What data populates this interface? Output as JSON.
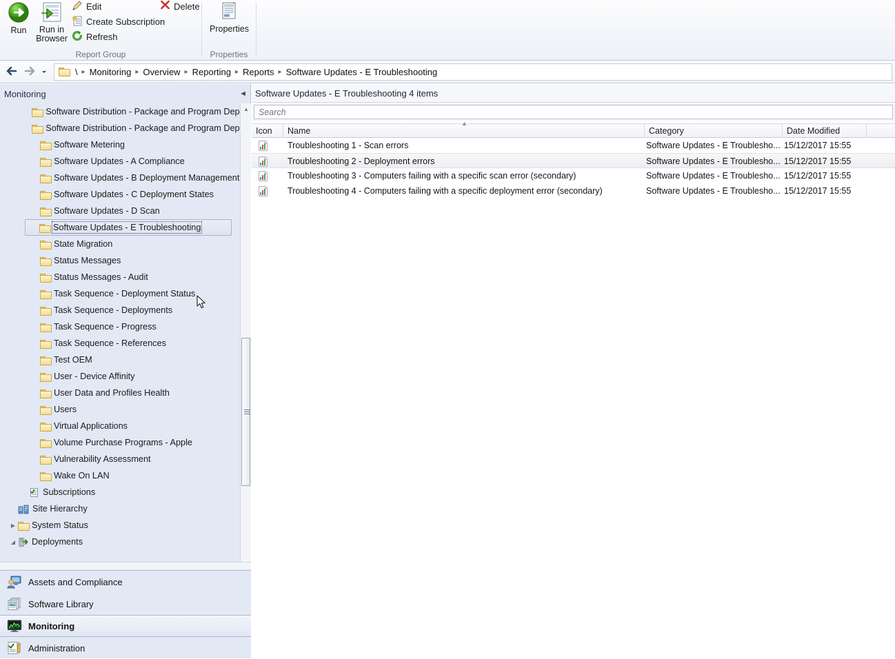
{
  "ribbon": {
    "groups": [
      {
        "label": "Report Group"
      },
      {
        "label": "Properties"
      }
    ],
    "run_label": "Run",
    "run_icon": "run-circle-arrow-icon",
    "run_in_browser_label": "Run in\nBrowser",
    "run_in_browser_line1": "Run in",
    "run_in_browser_line2": "Browser",
    "run_in_browser_icon": "document-arrow-icon",
    "edit_label": "Edit",
    "edit_icon": "pencil-icon",
    "create_subscription_label": "Create Subscription",
    "create_subscription_icon": "clipboard-star-icon",
    "refresh_label": "Refresh",
    "refresh_icon": "refresh-circle-icon",
    "delete_label": "Delete",
    "delete_icon": "red-x-icon",
    "properties_label": "Properties",
    "properties_icon": "properties-document-icon"
  },
  "breadcrumb": {
    "back_icon": "back-arrow-icon",
    "forward_icon": "forward-arrow-icon",
    "history_icon": "chevron-down-icon",
    "root_icon": "folder-icon",
    "root": "\\",
    "items": [
      "Monitoring",
      "Overview",
      "Reporting",
      "Reports",
      "Software Updates - E Troubleshooting"
    ],
    "separator": "▸"
  },
  "sidebar": {
    "title": "Monitoring",
    "collapse_icon": "collapse-left-icon",
    "scroll_up_icon": "scroll-up-arrow-icon",
    "scroll_down_icon": "scroll-down-arrow-icon",
    "tree": [
      {
        "label": "Software Distribution - Package and Program Deplo",
        "icon": "folder-icon",
        "indent": 2,
        "selected": false,
        "expander": ""
      },
      {
        "label": "Software Distribution - Package and Program Deplo",
        "icon": "folder-icon",
        "indent": 2,
        "selected": false,
        "expander": ""
      },
      {
        "label": "Software Metering",
        "icon": "folder-icon",
        "indent": 2,
        "selected": false,
        "expander": ""
      },
      {
        "label": "Software Updates - A Compliance",
        "icon": "folder-icon",
        "indent": 2,
        "selected": false,
        "expander": ""
      },
      {
        "label": "Software Updates - B Deployment Management",
        "icon": "folder-icon",
        "indent": 2,
        "selected": false,
        "expander": ""
      },
      {
        "label": "Software Updates - C Deployment States",
        "icon": "folder-icon",
        "indent": 2,
        "selected": false,
        "expander": ""
      },
      {
        "label": "Software Updates - D Scan",
        "icon": "folder-icon",
        "indent": 2,
        "selected": false,
        "expander": ""
      },
      {
        "label": "Software Updates - E Troubleshooting",
        "icon": "folder-icon",
        "indent": 2,
        "selected": true,
        "expander": ""
      },
      {
        "label": "State Migration",
        "icon": "folder-icon",
        "indent": 2,
        "selected": false,
        "expander": ""
      },
      {
        "label": "Status Messages",
        "icon": "folder-icon",
        "indent": 2,
        "selected": false,
        "expander": ""
      },
      {
        "label": "Status Messages - Audit",
        "icon": "folder-icon",
        "indent": 2,
        "selected": false,
        "expander": ""
      },
      {
        "label": "Task Sequence - Deployment Status",
        "icon": "folder-icon",
        "indent": 2,
        "selected": false,
        "expander": ""
      },
      {
        "label": "Task Sequence - Deployments",
        "icon": "folder-icon",
        "indent": 2,
        "selected": false,
        "expander": ""
      },
      {
        "label": "Task Sequence - Progress",
        "icon": "folder-icon",
        "indent": 2,
        "selected": false,
        "expander": ""
      },
      {
        "label": "Task Sequence - References",
        "icon": "folder-icon",
        "indent": 2,
        "selected": false,
        "expander": ""
      },
      {
        "label": "Test OEM",
        "icon": "folder-icon",
        "indent": 2,
        "selected": false,
        "expander": ""
      },
      {
        "label": "User - Device Affinity",
        "icon": "folder-icon",
        "indent": 2,
        "selected": false,
        "expander": ""
      },
      {
        "label": "User Data and Profiles Health",
        "icon": "folder-icon",
        "indent": 2,
        "selected": false,
        "expander": ""
      },
      {
        "label": "Users",
        "icon": "folder-icon",
        "indent": 2,
        "selected": false,
        "expander": ""
      },
      {
        "label": "Virtual Applications",
        "icon": "folder-icon",
        "indent": 2,
        "selected": false,
        "expander": ""
      },
      {
        "label": "Volume Purchase Programs - Apple",
        "icon": "folder-icon",
        "indent": 2,
        "selected": false,
        "expander": ""
      },
      {
        "label": "Vulnerability Assessment",
        "icon": "folder-icon",
        "indent": 2,
        "selected": false,
        "expander": ""
      },
      {
        "label": "Wake On LAN",
        "icon": "folder-icon",
        "indent": 2,
        "selected": false,
        "expander": ""
      },
      {
        "label": "Subscriptions",
        "icon": "subscriptions-icon",
        "indent": 1,
        "selected": false,
        "expander": ""
      },
      {
        "label": "Site Hierarchy",
        "icon": "site-hierarchy-icon",
        "indent": 0,
        "selected": false,
        "expander": ""
      },
      {
        "label": "System Status",
        "icon": "folder-icon",
        "indent": 0,
        "selected": false,
        "expander": "collapsed"
      },
      {
        "label": "Deployments",
        "icon": "deployments-icon",
        "indent": 0,
        "selected": false,
        "expander": "expanded"
      }
    ],
    "workspaces": [
      {
        "label": "Assets and Compliance",
        "icon": "assets-compliance-icon",
        "active": false
      },
      {
        "label": "Software Library",
        "icon": "software-library-icon",
        "active": false
      },
      {
        "label": "Monitoring",
        "icon": "monitoring-icon",
        "active": true
      },
      {
        "label": "Administration",
        "icon": "administration-icon",
        "active": false
      }
    ]
  },
  "main": {
    "list_title": "Software Updates - E Troubleshooting 4 items",
    "search": {
      "placeholder": "Search",
      "value": "",
      "icon": "search-icon"
    },
    "columns": [
      {
        "key": "icon",
        "label": "Icon",
        "sorted": false
      },
      {
        "key": "name",
        "label": "Name",
        "sorted": true,
        "sort_dir": "asc"
      },
      {
        "key": "category",
        "label": "Category",
        "sorted": false
      },
      {
        "key": "date",
        "label": "Date Modified",
        "sorted": false
      }
    ],
    "sort_indicator": "▲",
    "rows": [
      {
        "icon": "report-icon",
        "name": "Troubleshooting 1 - Scan errors",
        "category": "Software Updates - E Troublesho...",
        "date": "15/12/2017 15:55",
        "hover": false
      },
      {
        "icon": "report-icon",
        "name": "Troubleshooting 2 - Deployment errors",
        "category": "Software Updates - E Troublesho...",
        "date": "15/12/2017 15:55",
        "hover": true
      },
      {
        "icon": "report-icon",
        "name": "Troubleshooting 3 - Computers failing with a specific scan error (secondary)",
        "category": "Software Updates - E Troublesho...",
        "date": "15/12/2017 15:55",
        "hover": false
      },
      {
        "icon": "report-icon",
        "name": "Troubleshooting 4 - Computers failing with a specific deployment error (secondary)",
        "category": "Software Updates - E Troublesho...",
        "date": "15/12/2017 15:55",
        "hover": false
      }
    ]
  },
  "colors": {
    "sidebar_bg": "#e3e8f5",
    "ribbon_bg": "#f4f6fa",
    "accent_green": "#4ea72e",
    "accent_red": "#c8322b",
    "selection": "#dde3f2"
  }
}
